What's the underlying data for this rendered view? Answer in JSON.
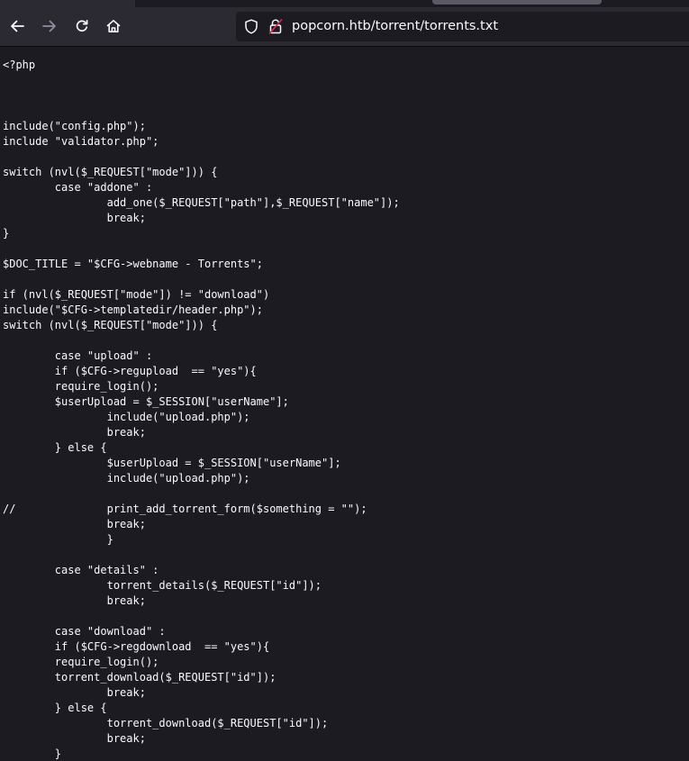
{
  "browser": {
    "url": "popcorn.htb/torrent/torrents.txt",
    "icons": {
      "back": "arrow-left-icon",
      "forward": "arrow-right-icon",
      "reload": "reload-icon",
      "home": "home-icon",
      "tracking": "shield-icon",
      "security": "broken-lock-icon"
    }
  },
  "document": {
    "source": "<?php\n\n\n\ninclude(\"config.php\");\ninclude \"validator.php\";\n\nswitch (nvl($_REQUEST[\"mode\"])) {\n\tcase \"addone\" :\n\t\tadd_one($_REQUEST[\"path\"],$_REQUEST[\"name\"]);\n\t\tbreak;\n}\n\n$DOC_TITLE = \"$CFG->webname - Torrents\";\n\nif (nvl($_REQUEST[\"mode\"]) != \"download\")\ninclude(\"$CFG->templatedir/header.php\");\nswitch (nvl($_REQUEST[\"mode\"])) {\n\n\tcase \"upload\" :\n\tif ($CFG->regupload  == \"yes\"){\n\trequire_login();\n\t$userUpload = $_SESSION[\"userName\"];\n\t\tinclude(\"upload.php\");\n\t\tbreak;\n\t} else {\n\t\t$userUpload = $_SESSION[\"userName\"];\n\t\tinclude(\"upload.php\");\n\n//\t\tprint_add_torrent_form($something = \"\");\n\t\tbreak;\n\t\t}\n\n\tcase \"details\" :\n\t\ttorrent_details($_REQUEST[\"id\"]);\n\t\tbreak;\n\n\tcase \"download\" :\n\tif ($CFG->regdownload  == \"yes\"){\n\trequire_login();\n\ttorrent_download($_REQUEST[\"id\"]);\n\t\tbreak;\n\t} else {\n\t\ttorrent_download($_REQUEST[\"id\"]);\n\t\tbreak;\n\t}"
  },
  "colors": {
    "page_background": "#1c1b22",
    "toolbar_background": "#2b2a33",
    "text": "#fbfbfe",
    "icon": "#fbfbfe",
    "icon_disabled": "#8f8f9d"
  }
}
